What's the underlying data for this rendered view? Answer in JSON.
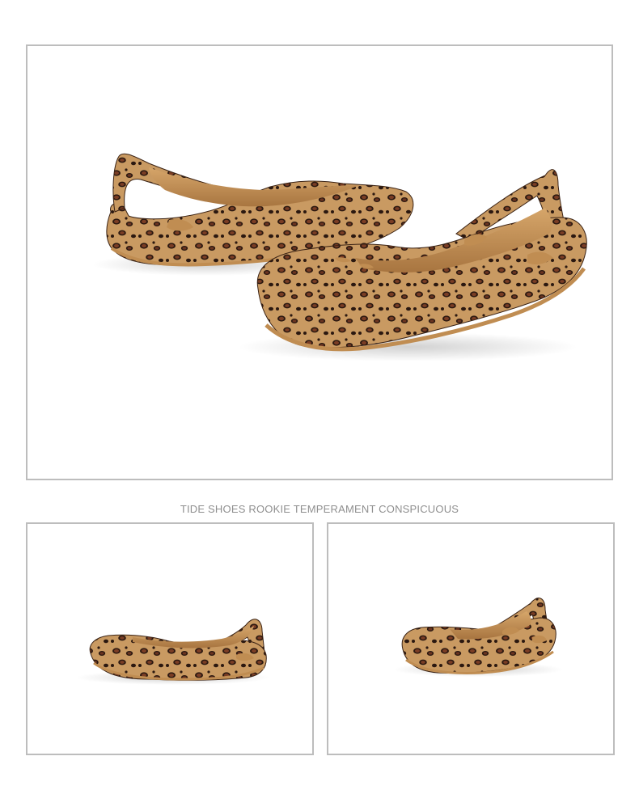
{
  "caption": "TIDE SHOES ROOKIE TEMPERAMENT CONSPICUOUS",
  "images": [
    {
      "name": "main-photo",
      "subject": "pair-of-leopard-print-slingback-clogs"
    },
    {
      "name": "thumb-left",
      "subject": "leopard-print-slingback-clog-side-view"
    },
    {
      "name": "thumb-right",
      "subject": "leopard-print-slingback-clog-angled-view"
    }
  ],
  "colors": {
    "frame_border": "#bdbdbd",
    "caption_text": "#8f8f8f",
    "leopard_base": "#c99a62",
    "leopard_spot": "#6b3420",
    "leopard_ring": "#2b1810",
    "insole": "#c08d52"
  }
}
